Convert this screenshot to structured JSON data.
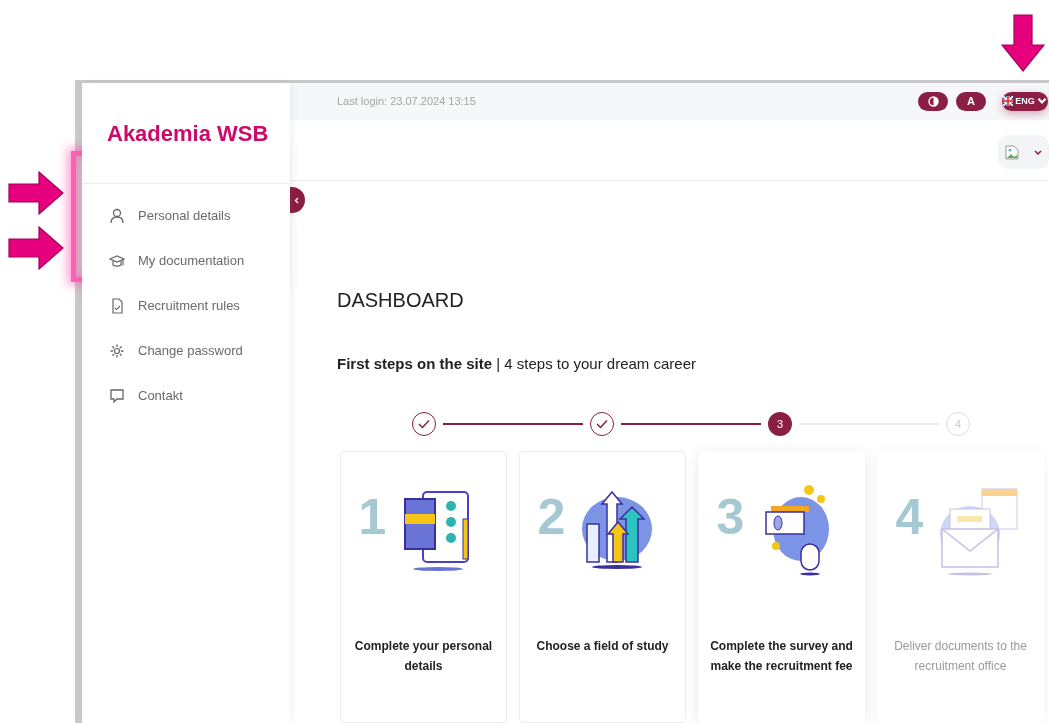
{
  "sidebar": {
    "logo": "Akademia WSB",
    "items": [
      {
        "label": "Personal details",
        "highlighted": true
      },
      {
        "label": "My documentation",
        "highlighted": true
      },
      {
        "label": "Recruitment rules",
        "highlighted": false
      },
      {
        "label": "Change password",
        "highlighted": false
      },
      {
        "label": "Contakt",
        "highlighted": false
      }
    ]
  },
  "top_bar": {
    "last_login": "Last login:  23.07.2024 13:15",
    "accessibility_button": "A",
    "language": "ENG",
    "language_highlighted": true
  },
  "page_title": "DASHBOARD",
  "subtitle": "**First steps on the site** | 4 steps to your dream career",
  "steps": [
    {
      "completed": true,
      "selected": false,
      "illustration_number": "1",
      "title": "Complete your personal details"
    },
    {
      "completed": true,
      "selected": false,
      "illustration_number": "2",
      "title": "Choose a field of study"
    },
    {
      "completed": false,
      "selected": true,
      "step_number": "3",
      "illustration_number": "3",
      "title": "Complete the survey and make the recruitment fee"
    },
    {
      "completed": false,
      "selected": false,
      "step_number": "4",
      "illustration_number": "4",
      "title": "Deliver documents to the recruitment office"
    }
  ]
}
